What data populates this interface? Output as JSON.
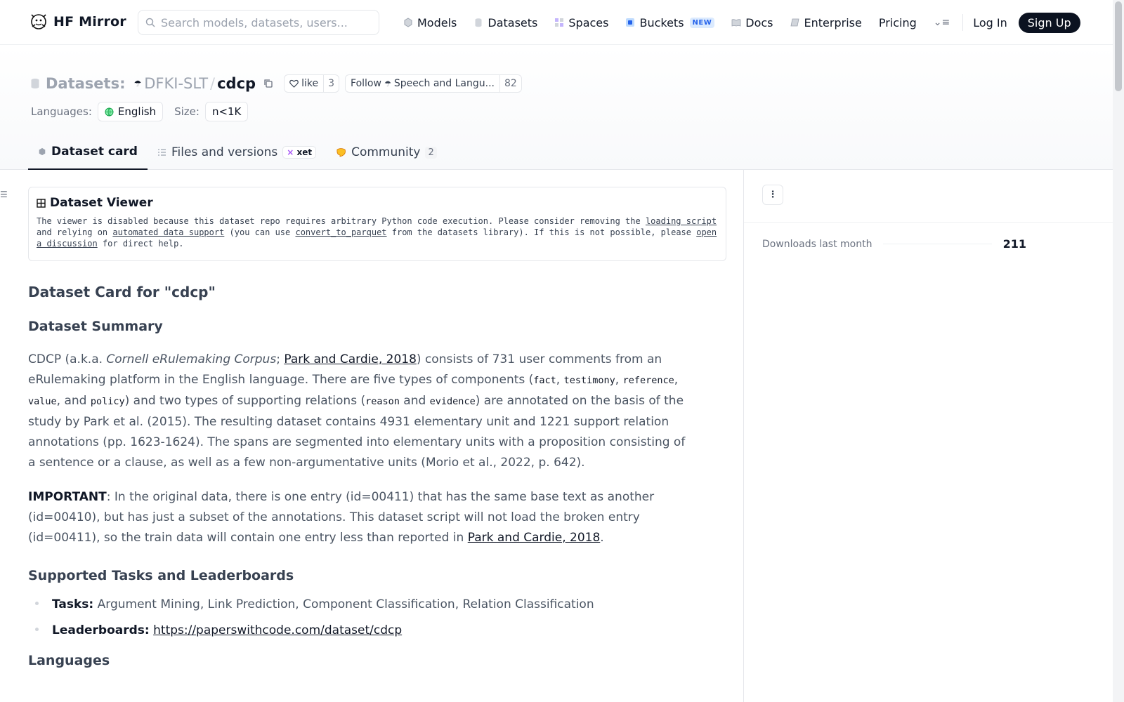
{
  "nav": {
    "brand": "HF Mirror",
    "search_placeholder": "Search models, datasets, users...",
    "links": [
      {
        "label": "Models",
        "icon": "cube-icon"
      },
      {
        "label": "Datasets",
        "icon": "database-icon"
      },
      {
        "label": "Spaces",
        "icon": "spaces-icon"
      },
      {
        "label": "Buckets",
        "icon": "bucket-icon",
        "badge": "NEW"
      },
      {
        "label": "Docs",
        "icon": "book-icon"
      },
      {
        "label": "Enterprise",
        "icon": "enterprise-icon"
      },
      {
        "label": "Pricing"
      }
    ],
    "login": "Log In",
    "signup": "Sign Up"
  },
  "repo": {
    "type_label": "Datasets:",
    "org": "DFKI-SLT",
    "slash": "/",
    "name": "cdcp",
    "like_label": "like",
    "like_count": "3",
    "follow_label": "Follow",
    "follow_org": "Speech and Langu...",
    "follow_count": "82"
  },
  "meta": {
    "languages_label": "Languages:",
    "language": "English",
    "size_label": "Size:",
    "size": "n<1K"
  },
  "tabs": {
    "dataset_card": "Dataset card",
    "files": "Files and versions",
    "xet": "xet",
    "community": "Community",
    "community_count": "2"
  },
  "viewer": {
    "title": "Dataset Viewer",
    "t1": "The viewer is disabled because this dataset repo requires arbitrary Python code execution. Please consider removing the ",
    "link1": "loading script",
    "t2": " and relying on ",
    "link2": "automated data support",
    "t3": " (you can use ",
    "link3": "convert_to_parquet",
    "t4": " from the datasets library). If this is not possible, please ",
    "link4": "open a discussion",
    "t5": " for direct help."
  },
  "card": {
    "title": "Dataset Card for \"cdcp\"",
    "summary_heading": "Dataset Summary",
    "s1": "CDCP (a.k.a. ",
    "s1_em": "Cornell eRulemaking Corpus",
    "s1b": "; ",
    "s_link": "Park and Cardie, 2018",
    "s2": ") consists of 731 user comments from an eRulemaking platform in the English language. There are five types of components (",
    "c_fact": "fact",
    "comma1": ", ",
    "c_testimony": "testimony",
    "comma2": ", ",
    "c_reference": "reference",
    "comma3": ", ",
    "c_value": "value",
    "and1": ", and ",
    "c_policy": "policy",
    "s3": ") and two types of supporting relations (",
    "c_reason": "reason",
    "and2": " and ",
    "c_evidence": "evidence",
    "s4": ") are annotated on the basis of the study by Park et al. (2015). The resulting dataset contains 4931 elementary unit and 1221 support relation annotations (pp. 1623-1624). The spans are segmented into elementary units with a proposition consisting of a sentence or a clause, as well as a few non-argumentative units (Morio et al., 2022, p. 642).",
    "important_label": "IMPORTANT",
    "important_text": ": In the original data, there is one entry (id=00411) that has the same base text as another (id=00410), but has just a subset of the annotations. This dataset script will not load the broken entry (id=00411), so the train data will contain one entry less than reported in ",
    "important_link": "Park and Cardie, 2018",
    "important_end": ".",
    "tasks_heading": "Supported Tasks and Leaderboards",
    "tasks_label": "Tasks:",
    "tasks_value": " Argument Mining, Link Prediction, Component Classification, Relation Classification",
    "leaderboards_label": "Leaderboards:",
    "leaderboards_link": "https://paperswithcode.com/dataset/cdcp",
    "languages_heading": "Languages"
  },
  "sidebar": {
    "downloads_label": "Downloads last month",
    "downloads_value": "211"
  },
  "colors": {
    "brand_dark": "#0b1220",
    "buckets_badge": "#2563eb",
    "muted_text": "#6b7280"
  }
}
